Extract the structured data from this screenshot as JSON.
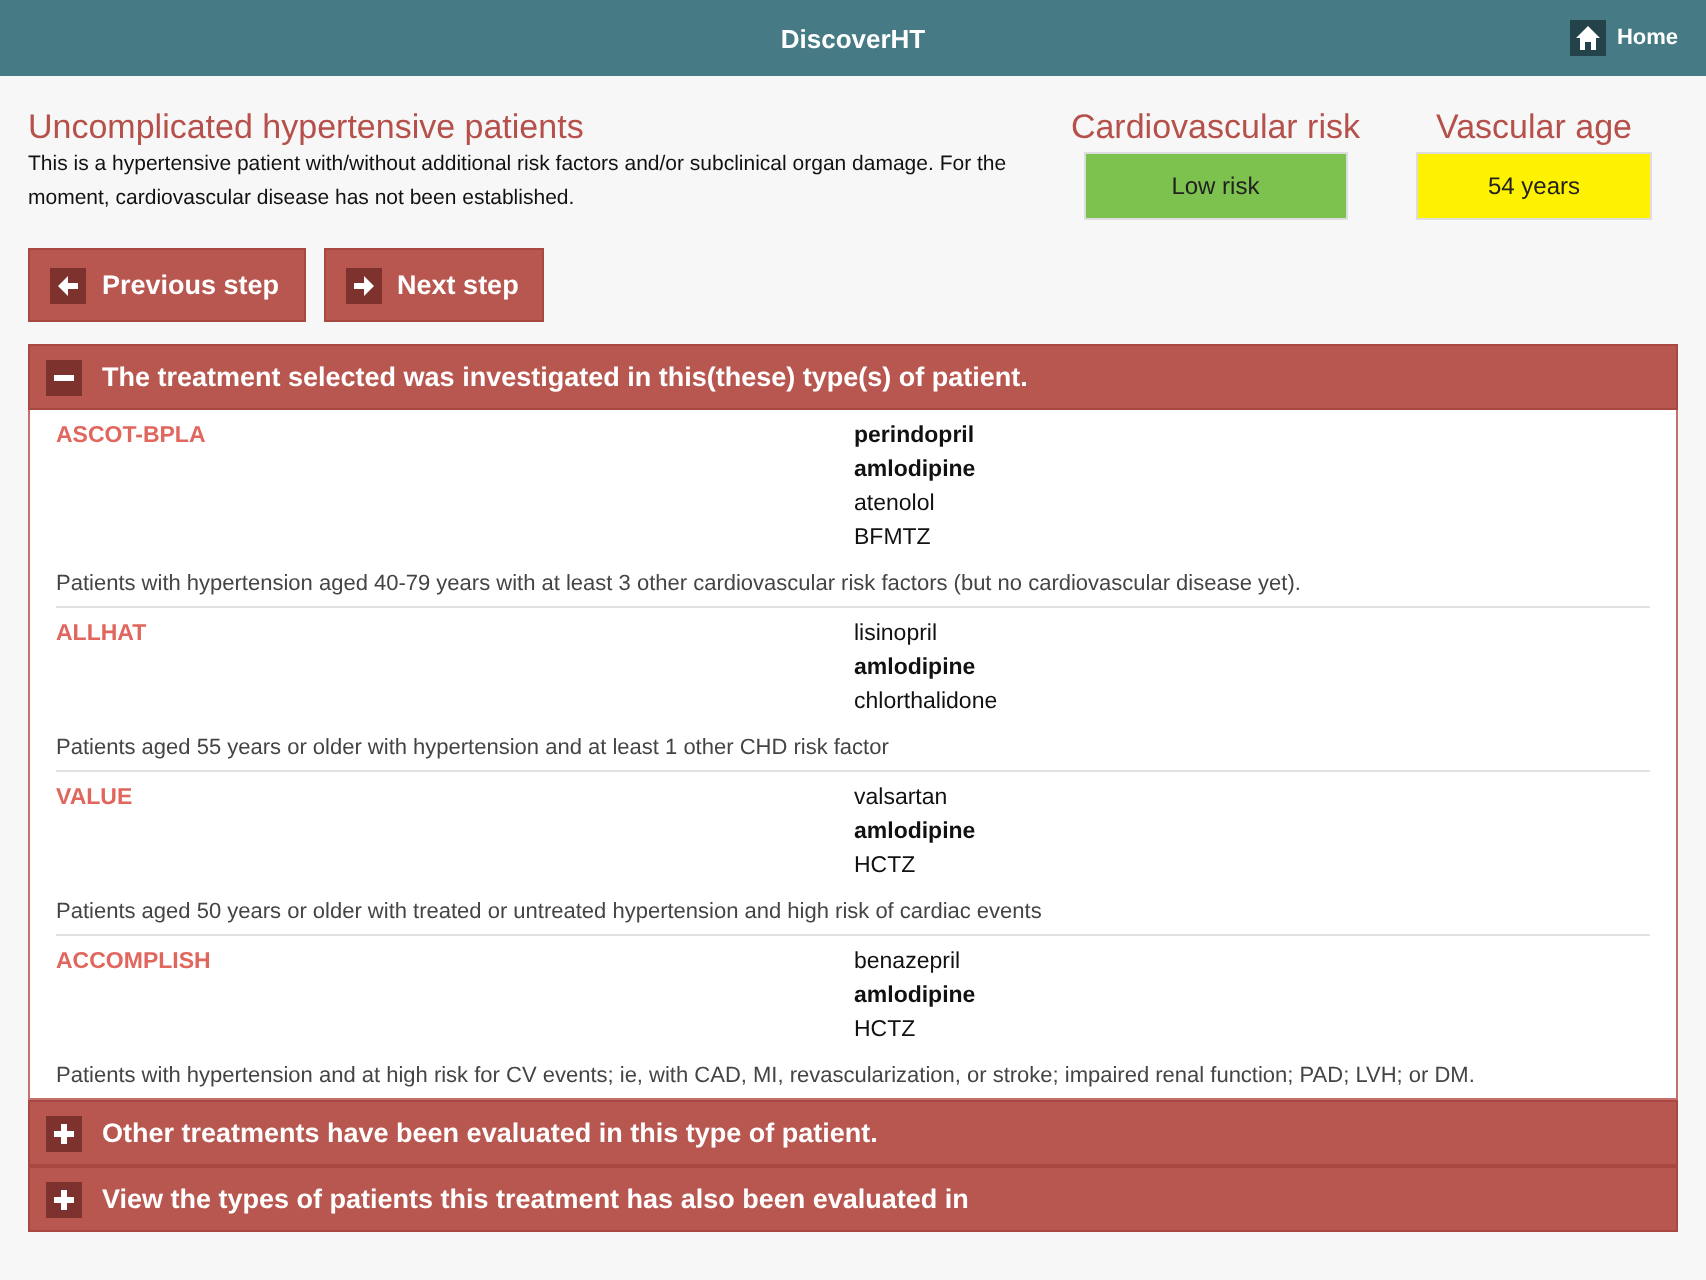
{
  "app_bar": {
    "title": "DiscoverHT",
    "home_label": "Home"
  },
  "patient_type": {
    "title": "Uncomplicated hypertensive patients",
    "description": "This is a hypertensive patient with/without additional risk factors and/or subclinical organ damage. For the moment, cardiovascular disease has not been established."
  },
  "risk": {
    "label": "Cardiovascular risk",
    "value": "Low risk",
    "color": "#7dc24f"
  },
  "vascular_age": {
    "label": "Vascular age",
    "value": "54 years",
    "color": "#fff200"
  },
  "nav_buttons": [
    {
      "label": "Previous step",
      "kind": "previous"
    },
    {
      "label": "Next step",
      "kind": "next"
    }
  ],
  "sections": [
    {
      "title": "The treatment selected was investigated in this(these) type(s) of patient.",
      "expanded": true,
      "trials": [
        {
          "name": "ASCOT-BPLA",
          "drugs": [
            {
              "name": "perindopril",
              "bold": true
            },
            {
              "name": "amlodipine",
              "bold": true
            },
            {
              "name": "atenolol",
              "bold": false
            },
            {
              "name": "BFMTZ",
              "bold": false
            }
          ],
          "population": "Patients with hypertension aged 40-79 years with at least 3 other cardiovascular risk factors (but no cardiovascular disease yet)."
        },
        {
          "name": "ALLHAT",
          "drugs": [
            {
              "name": "lisinopril",
              "bold": false
            },
            {
              "name": "amlodipine",
              "bold": true
            },
            {
              "name": "chlorthalidone",
              "bold": false
            }
          ],
          "population": "Patients aged 55 years or older with hypertension and at least 1 other CHD risk factor"
        },
        {
          "name": "VALUE",
          "drugs": [
            {
              "name": "valsartan",
              "bold": false
            },
            {
              "name": "amlodipine",
              "bold": true
            },
            {
              "name": "HCTZ",
              "bold": false
            }
          ],
          "population": "Patients aged 50 years or older with treated or untreated hypertension and high risk of cardiac events"
        },
        {
          "name": "ACCOMPLISH",
          "drugs": [
            {
              "name": "benazepril",
              "bold": false
            },
            {
              "name": "amlodipine",
              "bold": true
            },
            {
              "name": "HCTZ",
              "bold": false
            }
          ],
          "population": "Patients with hypertension and at high risk for CV events; ie, with CAD, MI, revascularization, or stroke; impaired renal function; PAD; LVH; or DM."
        }
      ]
    },
    {
      "title": "Other treatments have been evaluated in this type of patient.",
      "expanded": false
    },
    {
      "title": "View the types of patients this treatment has also been evaluated in",
      "expanded": false
    }
  ]
}
